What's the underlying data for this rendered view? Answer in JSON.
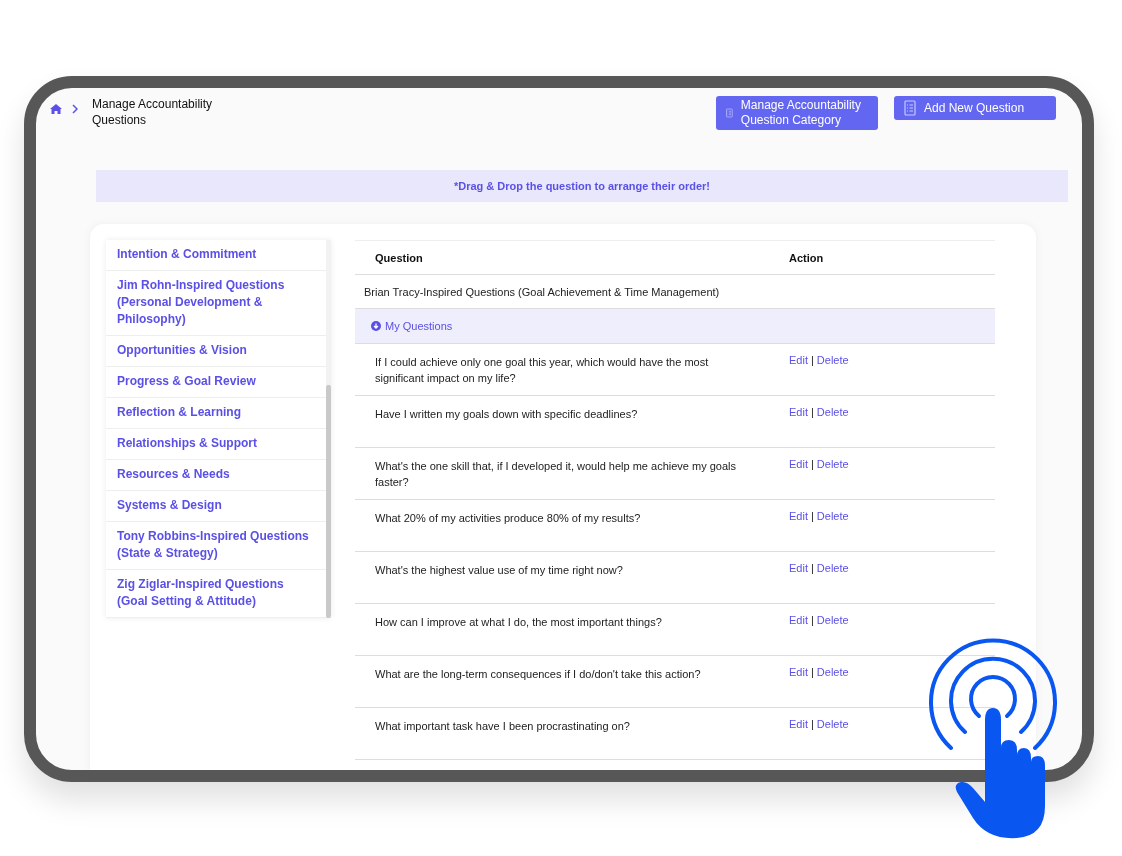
{
  "breadcrumb": {
    "title": "Manage Accountability Questions"
  },
  "buttons": [
    "Manage Accountability Question Category",
    "Add New Question"
  ],
  "notice": "*Drag & Drop the question to arrange their order!",
  "categories": [
    "Intention & Commitment",
    "Jim Rohn-Inspired Questions (Personal Development & Philosophy)",
    "Opportunities & Vision",
    "Progress & Goal Review",
    "Reflection & Learning",
    "Relationships & Support",
    "Resources & Needs",
    "Systems & Design",
    "Tony Robbins-Inspired Questions (State & Strategy)",
    "Zig Ziglar-Inspired Questions (Goal Setting & Attitude)"
  ],
  "table": {
    "columns": [
      "Question",
      "Action"
    ],
    "category": "Brian Tracy-Inspired Questions (Goal Achievement & Time Management)",
    "group": {
      "label": "My Questions",
      "expanded": true
    },
    "rows": [
      {
        "question": "If I could achieve only one goal this year, which would have the most significant impact on my life?",
        "edit": "Edit",
        "separator": "|",
        "delete": "Delete"
      },
      {
        "question": "Have I written my goals down with specific deadlines?",
        "edit": "Edit",
        "separator": "|",
        "delete": "Delete"
      },
      {
        "question": "What's the one skill that, if I developed it, would help me achieve my goals faster?",
        "edit": "Edit",
        "separator": "|",
        "delete": "Delete"
      },
      {
        "question": "What 20% of my activities produce 80% of my results?",
        "edit": "Edit",
        "separator": "|",
        "delete": "Delete"
      },
      {
        "question": "What's the highest value use of my time right now?",
        "edit": "Edit",
        "separator": "|",
        "delete": "Delete"
      },
      {
        "question": "How can I improve at what I do, the most important things?",
        "edit": "Edit",
        "separator": "|",
        "delete": "Delete"
      },
      {
        "question": "What are the long-term consequences if I do/don't take this action?",
        "edit": "Edit",
        "separator": "|",
        "delete": "Delete"
      },
      {
        "question": "What important task have I been procrastinating on?",
        "edit": "Edit",
        "separator": "|",
        "delete": "Delete"
      }
    ]
  }
}
